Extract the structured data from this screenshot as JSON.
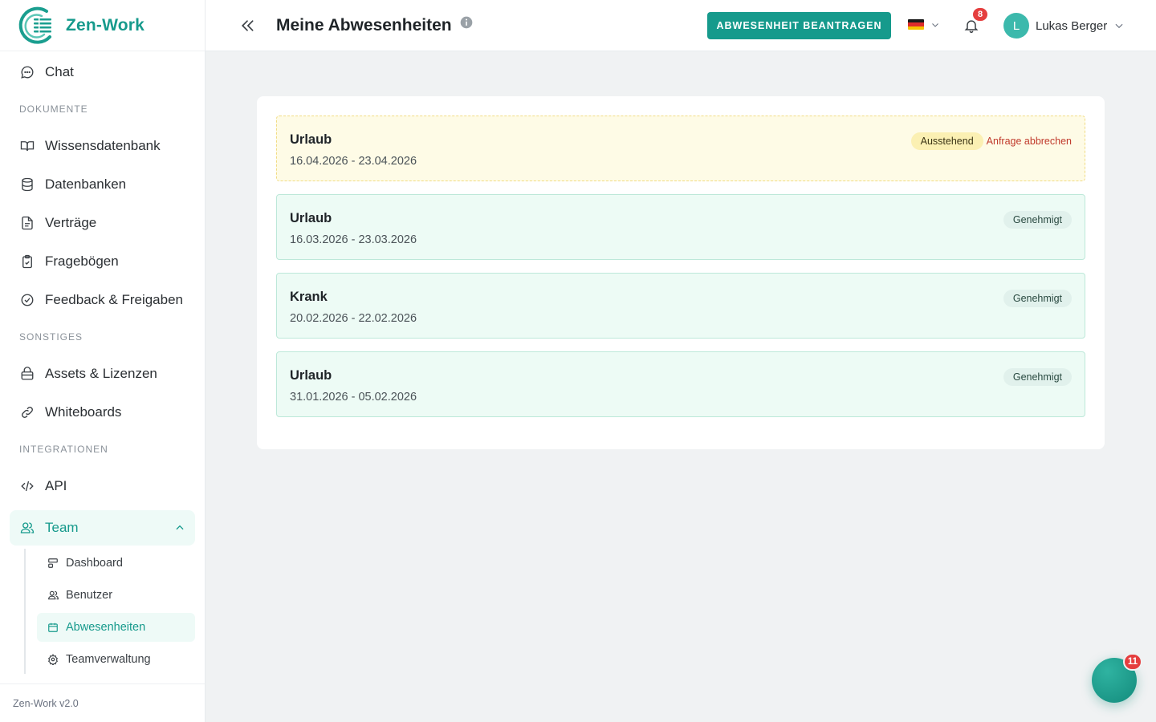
{
  "brand": {
    "name": "Zen-Work",
    "version": "Zen-Work v2.0"
  },
  "sidebar": {
    "chat": "Chat",
    "sections": {
      "documents": "DOKUMENTE",
      "other": "SONSTIGES",
      "integrations": "INTEGRATIONEN"
    },
    "documents_items": [
      "Wissensdatenbank",
      "Datenbanken",
      "Verträge",
      "Fragebögen",
      "Feedback & Freigaben"
    ],
    "other_items": [
      "Assets & Lizenzen",
      "Whiteboards"
    ],
    "integration_items": [
      "API"
    ],
    "team": {
      "label": "Team",
      "expanded": true,
      "children": [
        "Dashboard",
        "Benutzer",
        "Abwesenheiten",
        "Teamverwaltung"
      ],
      "active_child": "Abwesenheiten"
    }
  },
  "header": {
    "title": "Meine Abwesenheiten",
    "primary_button": "ABWESENHEIT BEANTRAGEN",
    "language": "de",
    "notification_count": "8",
    "user": {
      "initial": "L",
      "name": "Lukas Berger"
    }
  },
  "absences": [
    {
      "type": "Urlaub",
      "dates": "16.04.2026 - 23.04.2026",
      "status": "Ausstehend",
      "action": "Anfrage abbrechen"
    },
    {
      "type": "Urlaub",
      "dates": "16.03.2026 - 23.03.2026",
      "status": "Genehmigt"
    },
    {
      "type": "Krank",
      "dates": "20.02.2026 - 22.02.2026",
      "status": "Genehmigt"
    },
    {
      "type": "Urlaub",
      "dates": "31.01.2026 - 05.02.2026",
      "status": "Genehmigt"
    }
  ],
  "chat_widget": {
    "badge": "11"
  },
  "colors": {
    "brand": "#169a8c",
    "pending_bg": "#fefbe6",
    "approved_bg": "#edfbf5",
    "danger": "#e53e3e"
  }
}
